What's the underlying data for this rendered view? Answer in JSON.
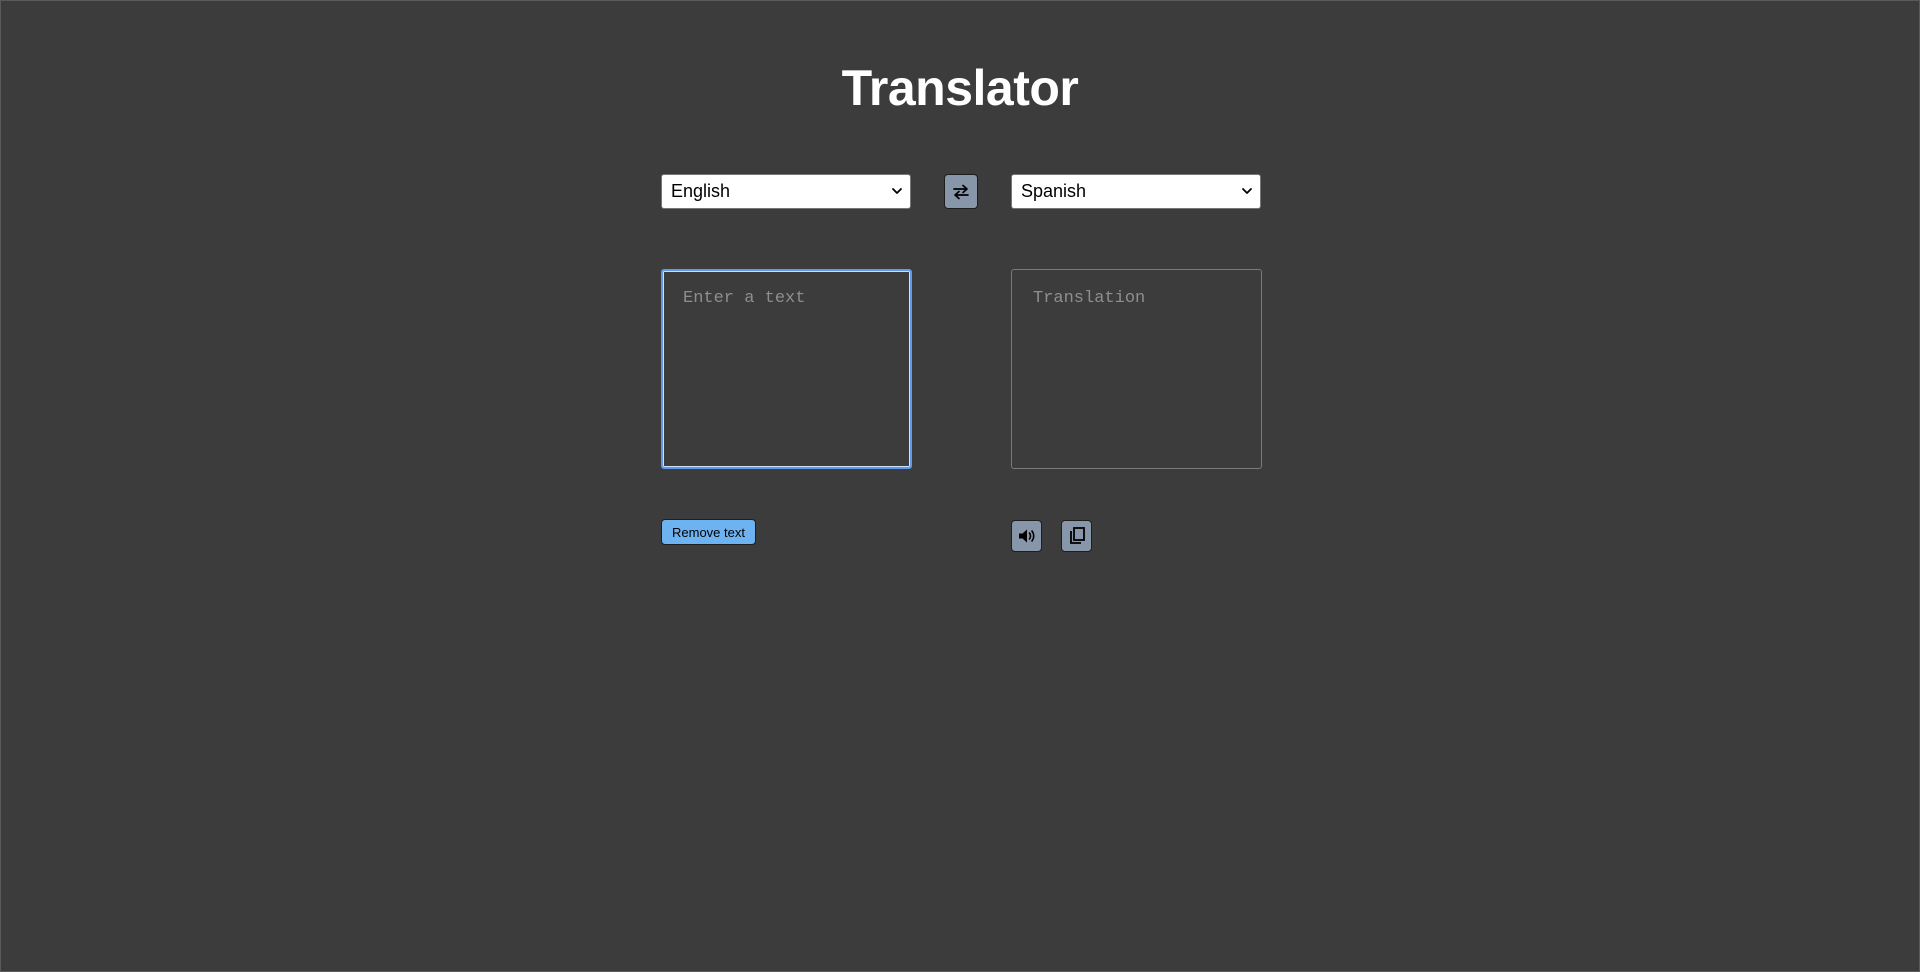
{
  "page": {
    "title": "Translator"
  },
  "languages": {
    "source": {
      "selected": "English"
    },
    "target": {
      "selected": "Spanish"
    }
  },
  "swap": {
    "icon": "swap-arrows-icon"
  },
  "inputs": {
    "source_placeholder": "Enter a text",
    "source_value": "",
    "target_placeholder": "Translation",
    "target_value": ""
  },
  "actions": {
    "remove_label": "Remove text",
    "speak_icon": "speaker-icon",
    "copy_icon": "copy-icon"
  },
  "colors": {
    "background": "#3c3c3c",
    "title": "#ffffff",
    "remove_button": "#6db3f2",
    "icon_button": "#8796a9",
    "focus_border": "#5f9bea"
  }
}
